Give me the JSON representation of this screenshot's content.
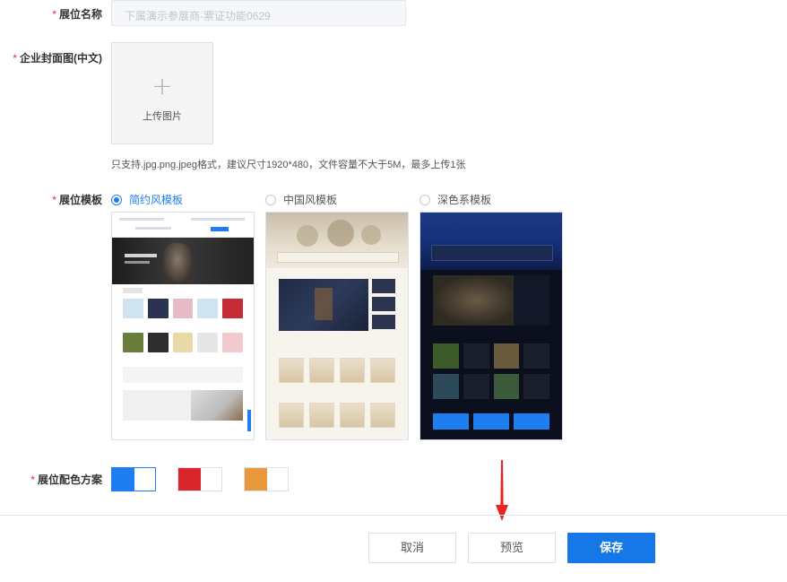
{
  "form": {
    "booth_name": {
      "required": "*",
      "label": "展位名称",
      "value": "下属演示参展商-票证功能0629"
    },
    "cover_image": {
      "required": "*",
      "label": "企业封面图(中文)",
      "upload_plus": "+",
      "upload_text": "上传图片",
      "hint": "只支持.jpg.png.jpeg格式，建议尺寸1920*480，文件容量不大于5M，最多上传1张"
    },
    "template": {
      "required": "*",
      "label": "展位模板",
      "options": [
        {
          "label": "简约风模板",
          "checked": true
        },
        {
          "label": "中国风模板",
          "checked": false
        },
        {
          "label": "深色系模板",
          "checked": false
        }
      ]
    },
    "color_scheme": {
      "required": "*",
      "label": "展位配色方案",
      "options": [
        {
          "color": "#1e7df0",
          "selected": true
        },
        {
          "color": "#d9262c",
          "selected": false
        },
        {
          "color": "#e8973a",
          "selected": false
        }
      ]
    }
  },
  "footer": {
    "cancel_label": "取消",
    "preview_label": "预览",
    "save_label": "保存"
  },
  "colors": {
    "accent": "#1677e6",
    "required": "#f5222d",
    "annotation_arrow": "#e8231f"
  }
}
